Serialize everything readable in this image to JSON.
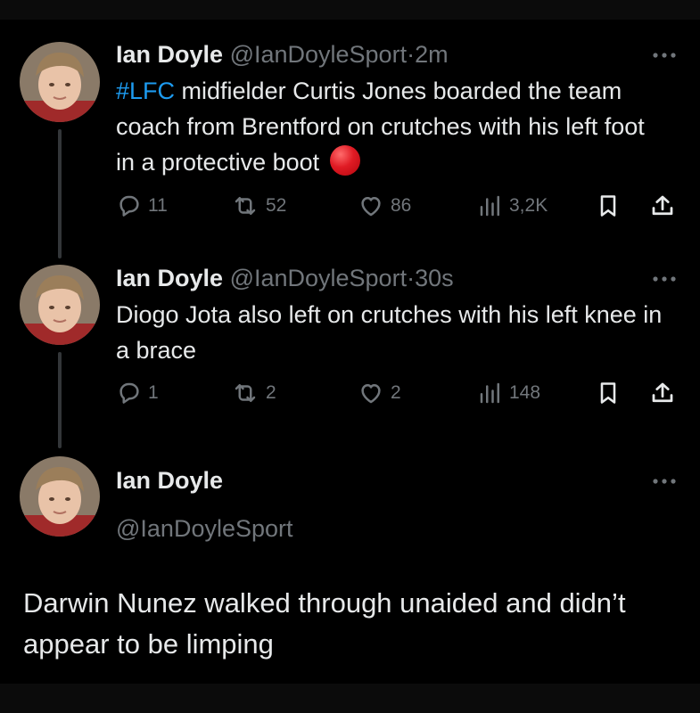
{
  "tweets": [
    {
      "name": "Ian Doyle",
      "handle": "@IanDoyleSport",
      "separator": "·",
      "time": "2m",
      "hashtag": "#LFC",
      "text": " midfielder Curtis Jones boarded the team coach from  Brentford on crutches with his left foot in a protective boot ",
      "replies": "11",
      "reposts": "52",
      "likes": "86",
      "views": "3,2K"
    },
    {
      "name": "Ian Doyle",
      "handle": "@IanDoyleSport",
      "separator": "·",
      "time": "30s",
      "text": "Diogo Jota also left on crutches with his left knee in a brace",
      "replies": "1",
      "reposts": "2",
      "likes": "2",
      "views": "148"
    },
    {
      "name": "Ian Doyle",
      "handle": "@IanDoyleSport",
      "text": "Darwin Nunez walked through unaided and didn’t appear to be limping"
    }
  ],
  "colors": {
    "background": "#000000",
    "text": "#e7e9ea",
    "muted": "#71767b",
    "link": "#1d9bf0",
    "thread_line": "#333639"
  },
  "icons": [
    "reply-icon",
    "repost-icon",
    "like-icon",
    "views-icon",
    "bookmark-icon",
    "share-icon",
    "more-icon",
    "red-circle-emoji"
  ]
}
